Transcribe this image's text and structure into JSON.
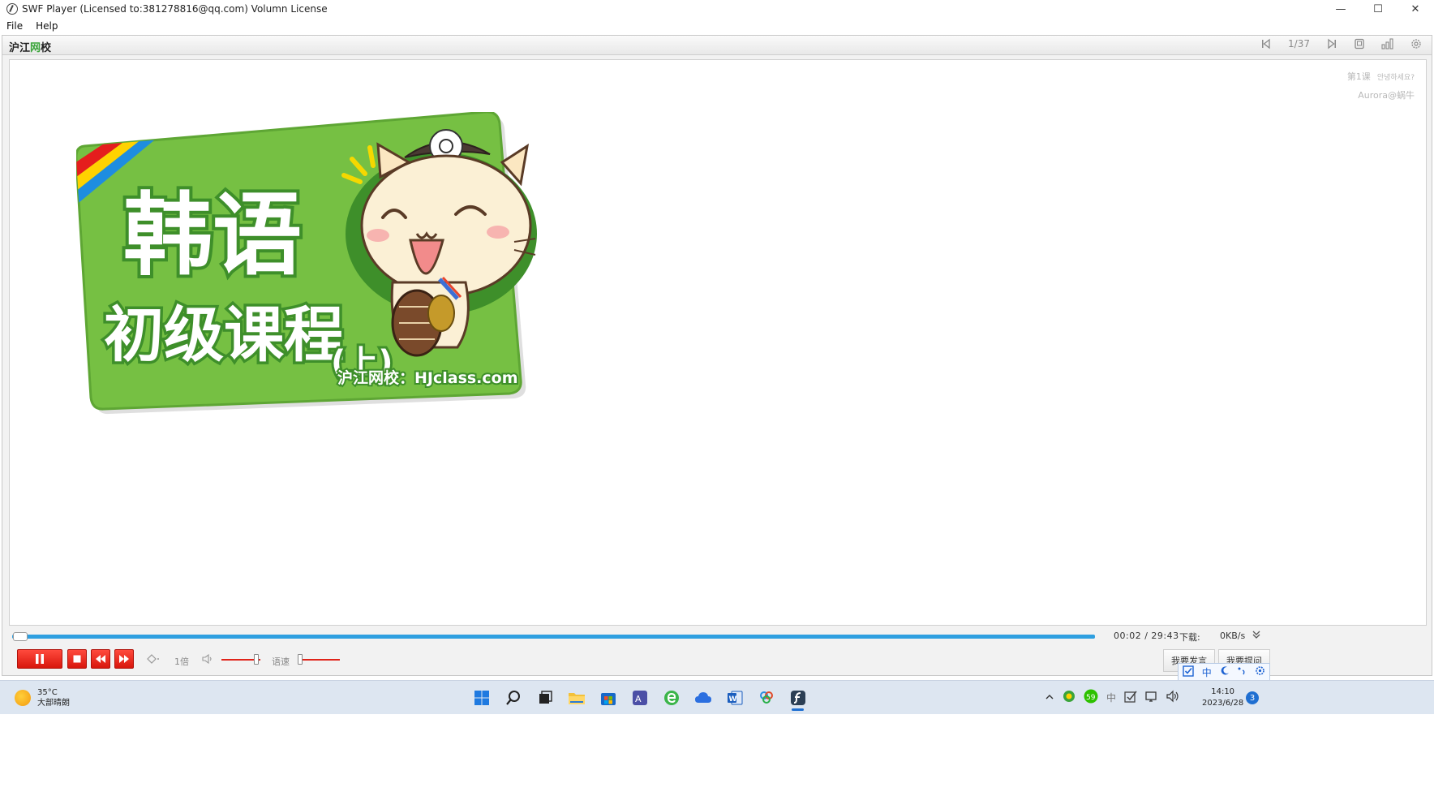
{
  "window": {
    "title": "SWF Player (Licensed to:381278816@qq.com) Volumn License",
    "minimize_glyph": "—",
    "maximize_glyph": "☐",
    "close_glyph": "✕"
  },
  "menu": {
    "items": [
      "File",
      "Help"
    ]
  },
  "player": {
    "brand_prefix": "沪江",
    "brand_green": "网",
    "brand_suffix": "校",
    "page_counter": "1/37",
    "lesson": "第1课",
    "lesson_korean": "안녕하세요?",
    "author": "Aurora@蜗牛"
  },
  "cover": {
    "title_line1": "韩语",
    "title_line2": "初级课程",
    "title_suffix": "(上)",
    "site": "沪江网校：HJclass.com"
  },
  "playback": {
    "progress_fraction": 0.001,
    "time_current": "00:02",
    "time_separator": "/",
    "time_total": "29:43",
    "download_label": "下载:",
    "download_speed": "0KB/s",
    "speed_label": "1倍",
    "rate_label": "语速",
    "volume_level": 0.9,
    "rate_level": 0.05,
    "speak_button": "我要发言",
    "ask_button": "我要提问"
  },
  "ime": {
    "mode": "中"
  },
  "taskbar": {
    "temperature": "35°C",
    "weather": "大部晴朗",
    "time": "14:10",
    "date": "2023/6/28",
    "notifications": "3",
    "ime_tray": "中"
  },
  "colors": {
    "progress": "#2e9fe0",
    "control_red": "#e0241a",
    "card_green": "#76c043",
    "card_border": "#3e8f2a",
    "accent_blue": "#1f6fd1"
  }
}
